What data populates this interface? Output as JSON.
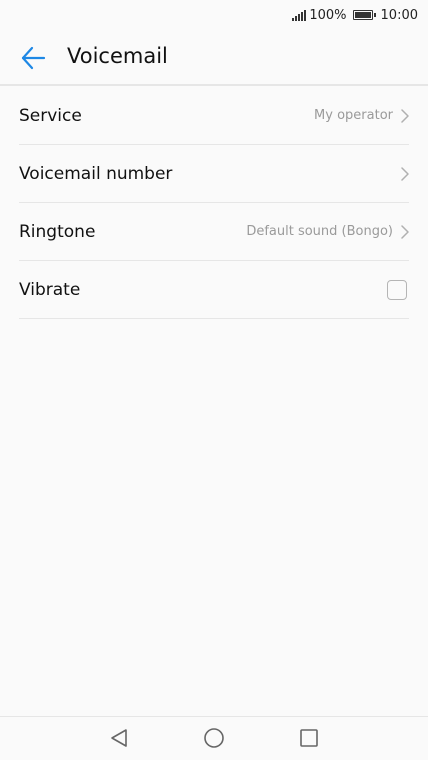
{
  "status_bar": {
    "battery_percent": "100%",
    "time": "10:00"
  },
  "header": {
    "title": "Voicemail"
  },
  "settings": {
    "items": [
      {
        "label": "Service",
        "value": "My operator"
      },
      {
        "label": "Voicemail number",
        "value": ""
      },
      {
        "label": "Ringtone",
        "value": "Default sound (Bongo)"
      },
      {
        "label": "Vibrate",
        "checked": false
      }
    ]
  },
  "icons": {
    "back": "arrow-left-icon",
    "chevron": "chevron-right-icon",
    "nav_back": "triangle-back-icon",
    "nav_home": "circle-home-icon",
    "nav_recent": "square-recent-icon"
  },
  "colors": {
    "accent": "#1e88e5",
    "background": "#fafafa",
    "secondary_text": "#9a9a9a",
    "divider": "#e6e6e6"
  }
}
